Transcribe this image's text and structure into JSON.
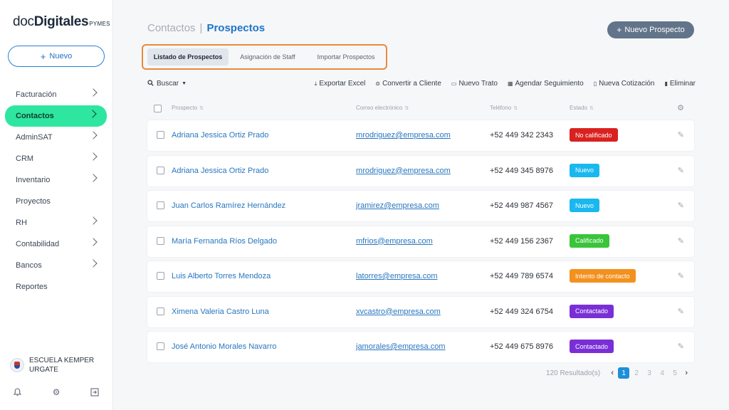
{
  "brand": {
    "prefix": "doc",
    "bold": "Digitales",
    "suffix": "PYMES"
  },
  "sidebar": {
    "new_label": "Nuevo",
    "items": [
      {
        "label": "Facturación",
        "chevron": true,
        "active": false
      },
      {
        "label": "Contactos",
        "chevron": true,
        "active": true
      },
      {
        "label": "AdminSAT",
        "chevron": true,
        "active": false
      },
      {
        "label": "CRM",
        "chevron": true,
        "active": false
      },
      {
        "label": "Inventario",
        "chevron": true,
        "active": false
      },
      {
        "label": "Proyectos",
        "chevron": false,
        "active": false
      },
      {
        "label": "RH",
        "chevron": true,
        "active": false
      },
      {
        "label": "Contabilidad",
        "chevron": true,
        "active": false
      },
      {
        "label": "Bancos",
        "chevron": true,
        "active": false
      },
      {
        "label": "Reportes",
        "chevron": false,
        "active": false
      }
    ],
    "org_line1": "ESCUELA KEMPER",
    "org_line2": "URGATE"
  },
  "header": {
    "crumb_parent": "Contactos",
    "crumb_separator": "|",
    "crumb_current": "Prospectos",
    "primary_button": "Nuevo Prospecto"
  },
  "tabs": [
    "Listado de Prospectos",
    "Asignación de Staff",
    "Importar Prospectos"
  ],
  "toolbar": {
    "search_label": "Buscar",
    "actions": [
      {
        "icon": "download-icon",
        "label": "Exportar Excel"
      },
      {
        "icon": "convert-icon",
        "label": "Convertir a Cliente"
      },
      {
        "icon": "briefcase-icon",
        "label": "Nuevo Trato"
      },
      {
        "icon": "calendar-icon",
        "label": "Agendar Seguimiento"
      },
      {
        "icon": "document-icon",
        "label": "Nueva Cotización"
      },
      {
        "icon": "trash-icon",
        "label": "Eliminar"
      }
    ]
  },
  "table": {
    "columns": [
      "Prospecto",
      "Correo electrónico",
      "Teléfono",
      "Estado"
    ],
    "rows": [
      {
        "name": "Adriana Jessica Ortiz Prado",
        "email": "mrodriguez@empresa.com",
        "phone": "+52 449 342 2343",
        "status": "No calificado",
        "status_color": "#d9211f"
      },
      {
        "name": "Adriana Jessica Ortiz Prado",
        "email": "mrodriguez@empresa.com",
        "phone": "+52 449 345 8976",
        "status": "Nuevo",
        "status_color": "#19b8ef"
      },
      {
        "name": "Juan Carlos Ramírez Hernández",
        "email": "jramirez@empresa.com",
        "phone": "+52 449 987 4567",
        "status": "Nuevo",
        "status_color": "#19b8ef"
      },
      {
        "name": "María Fernanda Ríos Delgado",
        "email": "mfrios@empresa.com",
        "phone": "+52 449 156 2367",
        "status": "Calificado",
        "status_color": "#3ac43a"
      },
      {
        "name": "Luis Alberto Torres Mendoza",
        "email": "latorres@empresa.com",
        "phone": "+52 449 789 6574",
        "status": "Intento de contacto",
        "status_color": "#f3911e"
      },
      {
        "name": "Ximena Valeria Castro Luna",
        "email": "xvcastro@empresa.com",
        "phone": "+52 449 324 6754",
        "status": "Contactado",
        "status_color": "#7a2fd6"
      },
      {
        "name": "José Antonio Morales Navarro",
        "email": "jamorales@empresa.com",
        "phone": "+52 449 675 8976",
        "status": "Contactado",
        "status_color": "#7a2fd6"
      }
    ]
  },
  "pagination": {
    "results": "120 Resultado(s)",
    "pages": [
      "1",
      "2",
      "3",
      "4",
      "5"
    ],
    "current": "1"
  }
}
